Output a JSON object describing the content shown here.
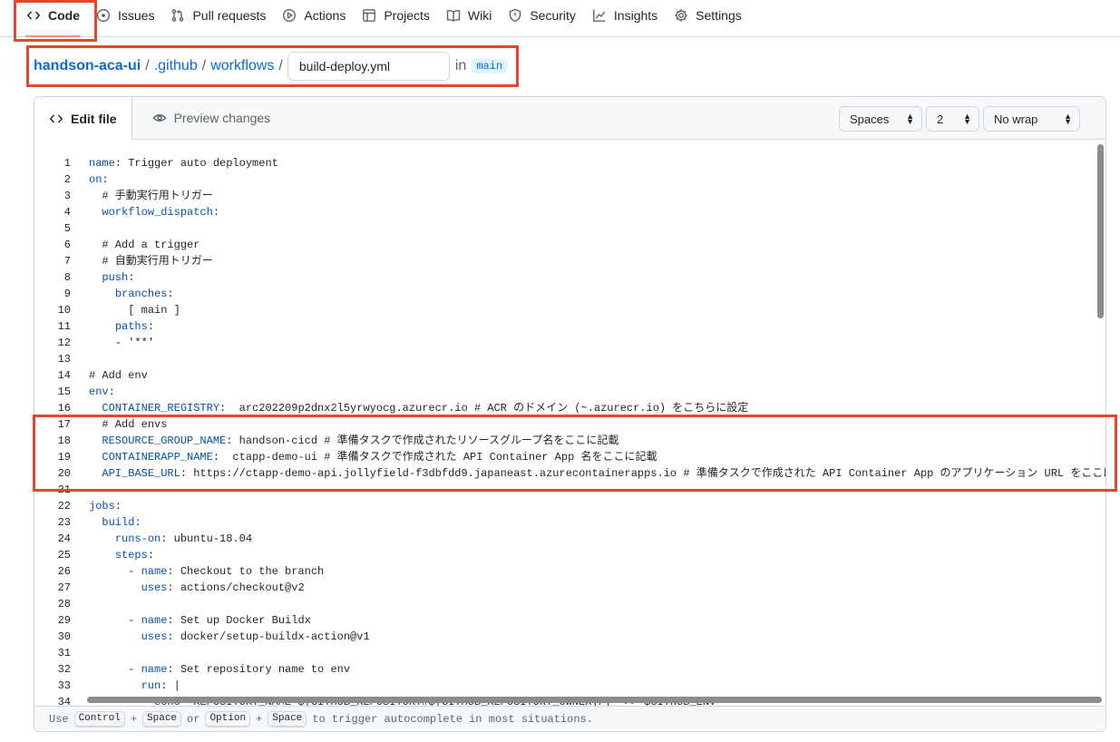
{
  "nav": {
    "items": [
      {
        "label": "Code",
        "icon": "code-icon",
        "selected": true
      },
      {
        "label": "Issues",
        "icon": "issue-circle-icon"
      },
      {
        "label": "Pull requests",
        "icon": "git-pull-request-icon"
      },
      {
        "label": "Actions",
        "icon": "play-icon"
      },
      {
        "label": "Projects",
        "icon": "table-icon"
      },
      {
        "label": "Wiki",
        "icon": "book-icon"
      },
      {
        "label": "Security",
        "icon": "shield-icon"
      },
      {
        "label": "Insights",
        "icon": "graph-icon"
      },
      {
        "label": "Settings",
        "icon": "gear-icon"
      }
    ]
  },
  "breadcrumb": {
    "repo": "handson-aca-ui",
    "dir1": ".github",
    "dir2": "workflows",
    "sep": "/",
    "filename": "build-deploy.yml",
    "in_word": "in",
    "branch": "main"
  },
  "editor": {
    "tab_edit": "Edit file",
    "tab_preview": "Preview changes",
    "indent_mode": "Spaces",
    "indent_size": "2",
    "wrap_mode": "No wrap",
    "lines": [
      {
        "n": "1",
        "key": "name",
        "rest": ": Trigger auto deployment",
        "indent": ""
      },
      {
        "n": "2",
        "key": "on",
        "rest": ":",
        "indent": ""
      },
      {
        "n": "3",
        "key": "",
        "rest": "# 手動実行用トリガー",
        "indent": "  "
      },
      {
        "n": "4",
        "key": "workflow_dispatch",
        "rest": ":",
        "indent": "  "
      },
      {
        "n": "5",
        "key": "",
        "rest": "",
        "indent": ""
      },
      {
        "n": "6",
        "key": "",
        "rest": "# Add a trigger",
        "indent": "  "
      },
      {
        "n": "7",
        "key": "",
        "rest": "# 自動実行用トリガー",
        "indent": "  "
      },
      {
        "n": "8",
        "key": "push",
        "rest": ":",
        "indent": "  "
      },
      {
        "n": "9",
        "key": "branches",
        "rest": ":",
        "indent": "    "
      },
      {
        "n": "10",
        "key": "",
        "rest": "[ main ]",
        "indent": "      "
      },
      {
        "n": "11",
        "key": "paths",
        "rest": ":",
        "indent": "    "
      },
      {
        "n": "12",
        "key": "",
        "rest": "- '**'",
        "indent": "    "
      },
      {
        "n": "13",
        "key": "",
        "rest": "",
        "indent": ""
      },
      {
        "n": "14",
        "key": "",
        "rest": "# Add env",
        "indent": ""
      },
      {
        "n": "15",
        "key": "env",
        "rest": ":",
        "indent": ""
      },
      {
        "n": "16",
        "key": "CONTAINER_REGISTRY",
        "rest": ":  arc202209p2dnx2l5yrwyocg.azurecr.io # ACR のドメイン (~.azurecr.io) をこちらに設定",
        "indent": "  "
      },
      {
        "n": "17",
        "key": "",
        "rest": "# Add envs",
        "indent": "  "
      },
      {
        "n": "18",
        "key": "RESOURCE_GROUP_NAME",
        "rest": ": handson-cicd # 準備タスクで作成されたリソースグループ名をここに記載",
        "indent": "  "
      },
      {
        "n": "19",
        "key": "CONTAINERAPP_NAME",
        "rest": ":  ctapp-demo-ui # 準備タスクで作成された API Container App 名をここに記載",
        "indent": "  "
      },
      {
        "n": "20",
        "key": "API_BASE_URL",
        "rest": ": https://ctapp-demo-api.jollyfield-f3dbfdd9.japaneast.azurecontainerapps.io # 準備タスクで作成された API Container App のアプリケーション URL をここに記載",
        "indent": "  "
      },
      {
        "n": "21",
        "key": "",
        "rest": "",
        "indent": ""
      },
      {
        "n": "22",
        "key": "jobs",
        "rest": ":",
        "indent": ""
      },
      {
        "n": "23",
        "key": "build",
        "rest": ":",
        "indent": "  "
      },
      {
        "n": "24",
        "key": "runs-on",
        "rest": ": ubuntu-18.04",
        "indent": "    "
      },
      {
        "n": "25",
        "key": "steps",
        "rest": ":",
        "indent": "    "
      },
      {
        "n": "26",
        "key": "name",
        "rest": ": Checkout to the branch",
        "indent": "      - "
      },
      {
        "n": "27",
        "key": "uses",
        "rest": ": actions/checkout@v2",
        "indent": "        "
      },
      {
        "n": "28",
        "key": "",
        "rest": "",
        "indent": ""
      },
      {
        "n": "29",
        "key": "name",
        "rest": ": Set up Docker Buildx",
        "indent": "      - "
      },
      {
        "n": "30",
        "key": "uses",
        "rest": ": docker/setup-buildx-action@v1",
        "indent": "        "
      },
      {
        "n": "31",
        "key": "",
        "rest": "",
        "indent": ""
      },
      {
        "n": "32",
        "key": "name",
        "rest": ": Set repository name to env",
        "indent": "      - "
      },
      {
        "n": "33",
        "key": "run",
        "rest": ": |",
        "indent": "        "
      },
      {
        "n": "34",
        "key": "",
        "rest": "echo \"REPOSITORY_NAME=${GITHUB_REPOSITORY#${GITHUB_REPOSITORY_OWNER}/}\" >> $GITHUB_ENV",
        "indent": "          "
      }
    ]
  },
  "footer": {
    "use": "Use",
    "key_control": "Control",
    "plus1": "+",
    "key_space1": "Space",
    "or": "or",
    "key_option": "Option",
    "plus2": "+",
    "key_space2": "Space",
    "tail": "to trigger autocomplete in most situations."
  },
  "colors": {
    "annotation": "#e5462d",
    "link": "#0969da",
    "yaml_key": "#0550ae",
    "selected_tab_underline": "#fd8c73"
  }
}
